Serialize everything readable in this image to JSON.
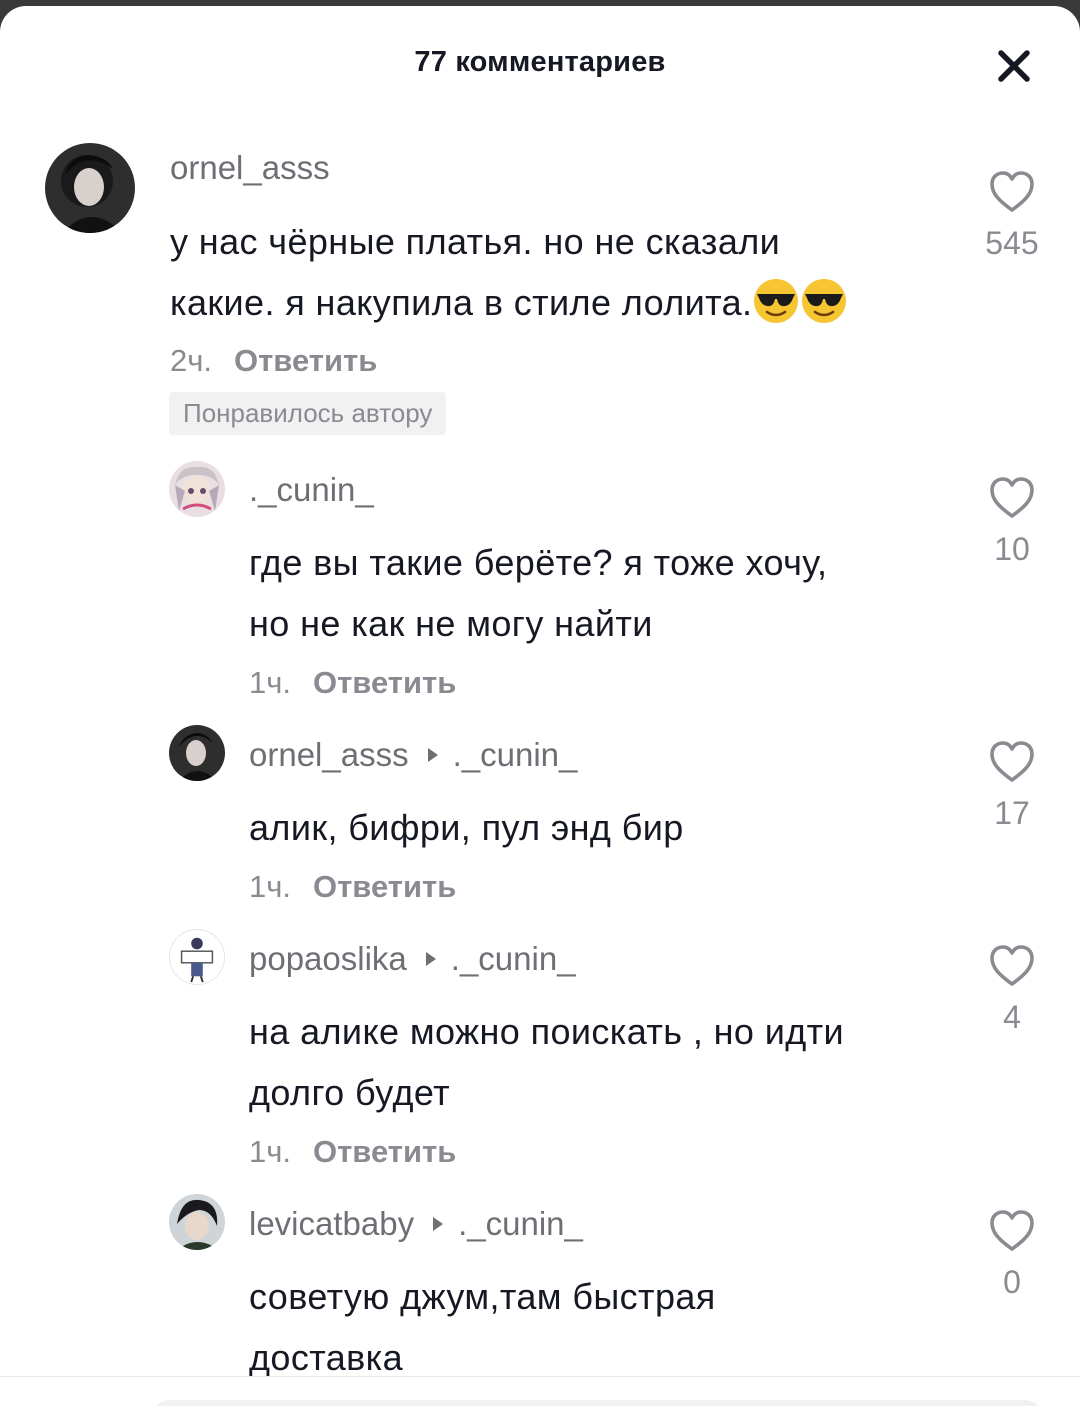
{
  "header": {
    "title": "77 комментариев"
  },
  "colors": {
    "text_primary": "#161823",
    "text_secondary": "#8a8b91",
    "badge_bg": "#f1f1f2"
  },
  "comments": [
    {
      "username": "ornel_asss",
      "reply_to": "",
      "text_lines": [
        "у нас чёрные платья. но не сказали",
        "какие. я накупила в стиле лолита."
      ],
      "emoji": [
        "smiling-face-with-sunglasses",
        "smiling-face-with-sunglasses"
      ],
      "time": "2ч.",
      "reply_label": "Ответить",
      "badge": "Понравилось автору",
      "likes": "545",
      "icon": "heart-outline-icon"
    },
    {
      "username": "._cunin_",
      "reply_to": "",
      "text_lines": [
        "где вы такие берёте? я тоже хочу,",
        "но не как не могу найти"
      ],
      "time": "1ч.",
      "reply_label": "Ответить",
      "likes": "10",
      "icon": "heart-outline-icon"
    },
    {
      "username": "ornel_asss",
      "reply_to": "._cunin_",
      "text_lines": [
        "алик, бифри, пул энд бир"
      ],
      "time": "1ч.",
      "reply_label": "Ответить",
      "likes": "17",
      "icon": "heart-outline-icon"
    },
    {
      "username": "popaoslika",
      "reply_to": "._cunin_",
      "text_lines": [
        "на алике можно поискать , но идти",
        "долго будет"
      ],
      "time": "1ч.",
      "reply_label": "Ответить",
      "likes": "4",
      "icon": "heart-outline-icon"
    },
    {
      "username": "levicatbaby",
      "reply_to": "._cunin_",
      "text_lines": [
        "советую джум,там быстрая",
        "доставка"
      ],
      "likes": "0",
      "icon": "heart-outline-icon"
    }
  ]
}
